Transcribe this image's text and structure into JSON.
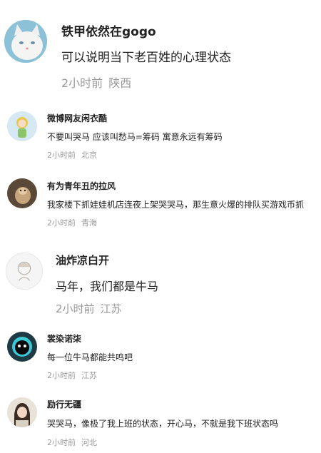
{
  "comments": [
    {
      "username": "铁甲依然在gogo",
      "text": "可以说明当下老百姓的心理状态",
      "time": "2小时前",
      "location": "陕西",
      "avatar_icon": "white-cat-avatar"
    },
    {
      "username": "微博网友闲衣酷",
      "text": "不要叫哭马 应该叫愁马=筹码 寓意永远有筹码",
      "time": "2小时前",
      "location": "北京",
      "avatar_icon": "cartoon-girl-avatar"
    },
    {
      "username": "有为青年丑的拉风",
      "text": "我家楼下抓娃娃机店连夜上架哭哭马，那生意火爆的排队买游戏币抓",
      "time": "2小时前",
      "location": "青海",
      "avatar_icon": "dog-photo-avatar"
    },
    {
      "username": "油炸凉白开",
      "text": "马年，我们都是牛马",
      "time": "2小时前",
      "location": "江苏",
      "avatar_icon": "sketch-girl-avatar"
    },
    {
      "username": "裳染诺柒",
      "text": "每一位牛马都能共鸣吧",
      "time": "2小时前",
      "location": "江苏",
      "avatar_icon": "black-creature-avatar"
    },
    {
      "username": "励行无疆",
      "text": "哭哭马，像极了我上班的状态，开心马，不就是我下班状态吗",
      "time": "2小时前",
      "location": "河北",
      "avatar_icon": "girl-photo-avatar"
    }
  ]
}
